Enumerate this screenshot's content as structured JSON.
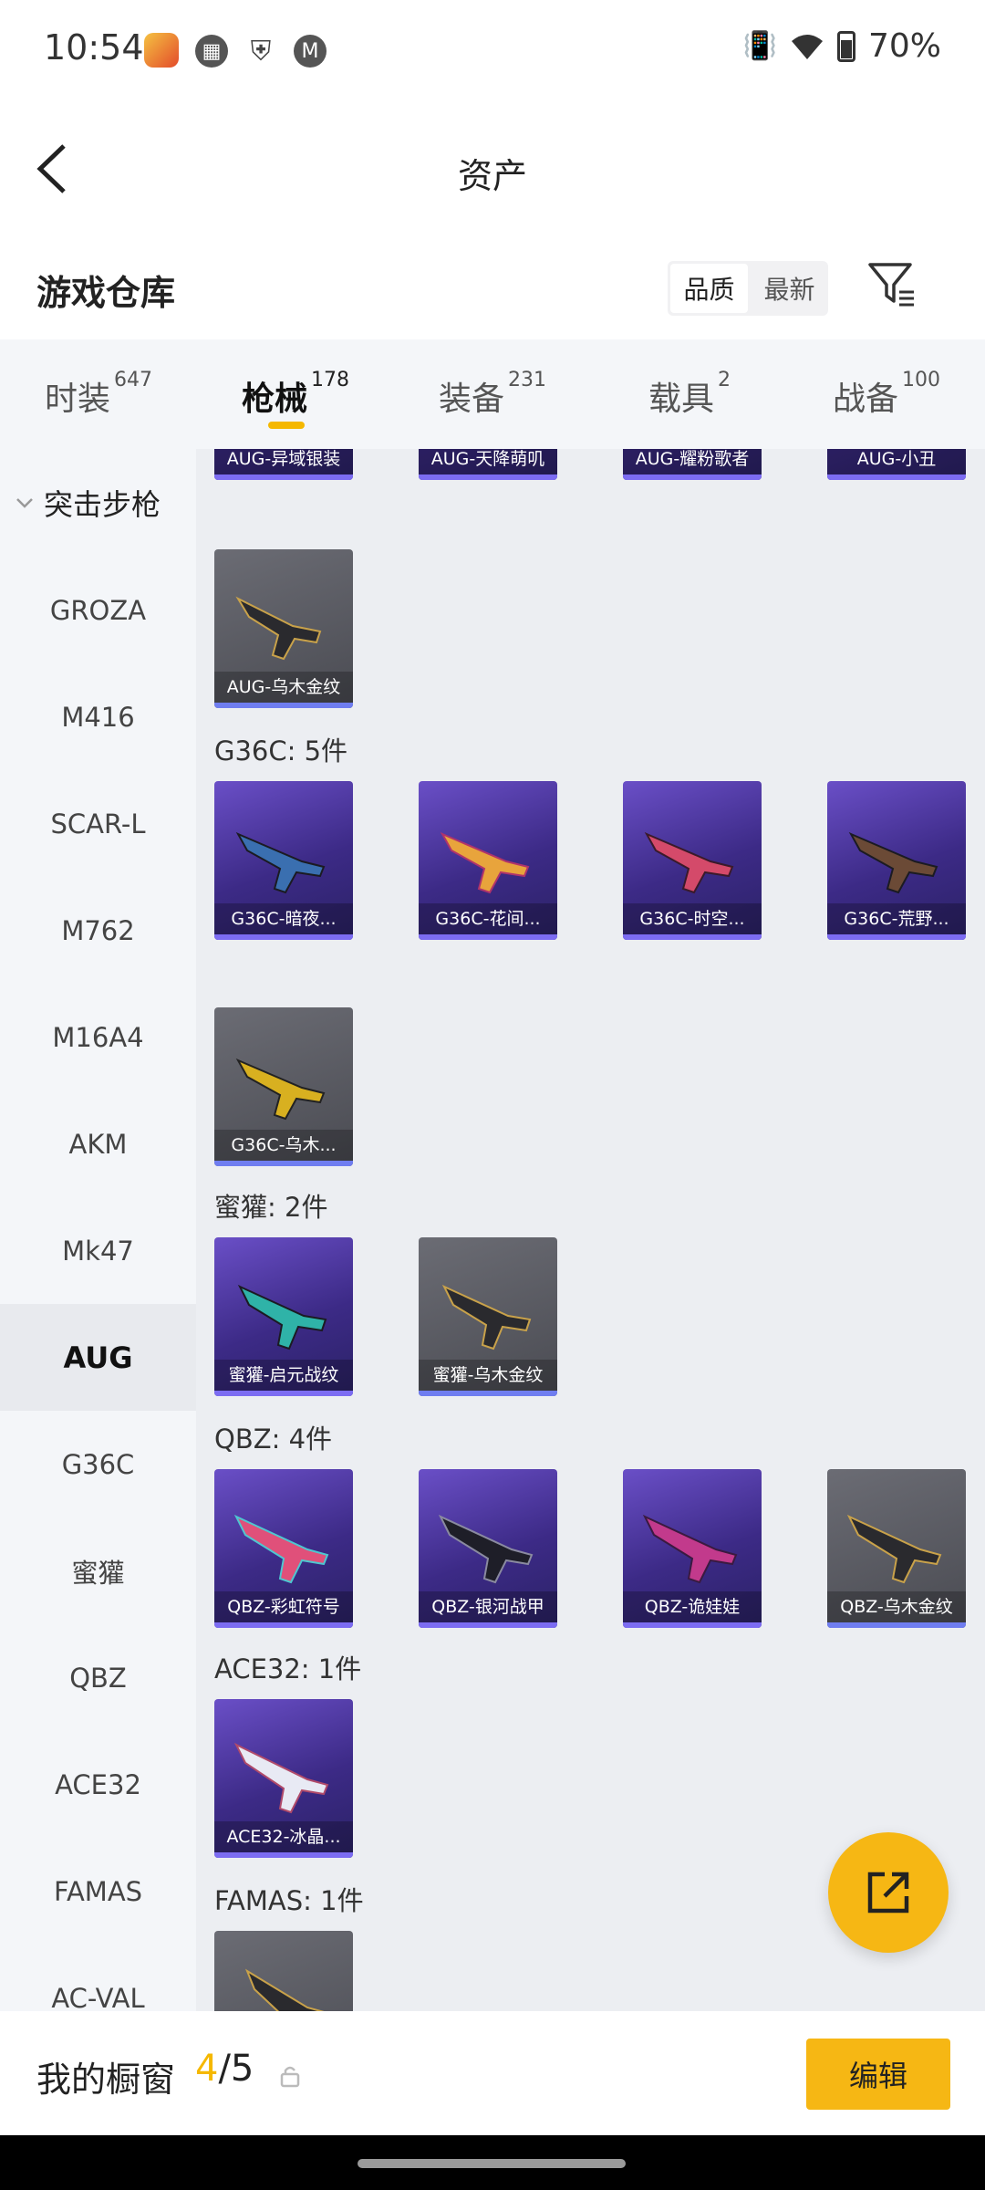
{
  "status_bar": {
    "time": "10:54",
    "battery": "70%"
  },
  "header": {
    "title": "资产"
  },
  "section": {
    "title": "游戏仓库",
    "sort_options": [
      "品质",
      "最新"
    ]
  },
  "tabs": [
    {
      "label": "时装",
      "count": "647"
    },
    {
      "label": "枪械",
      "count": "178"
    },
    {
      "label": "装备",
      "count": "231"
    },
    {
      "label": "载具",
      "count": "2"
    },
    {
      "label": "战备",
      "count": "100"
    }
  ],
  "sidebar": {
    "group": "突击步枪",
    "items": [
      "GROZA",
      "M416",
      "SCAR-L",
      "M762",
      "M16A4",
      "AKM",
      "Mk47",
      "AUG",
      "G36C",
      "蜜獾",
      "QBZ",
      "ACE32",
      "FAMAS",
      "AC-VAL"
    ],
    "active_index": 7
  },
  "groups": {
    "g36c": "G36C: 5件",
    "mihuan": "蜜獾: 2件",
    "qbz": "QBZ: 4件",
    "ace32": "ACE32: 1件",
    "famas": "FAMAS: 1件"
  },
  "cards": {
    "aug_row": [
      "AUG-异域银装",
      "AUG-天降萌叽",
      "AUG-耀粉歌者",
      "AUG-小丑"
    ],
    "aug_last": "AUG-乌木金纹",
    "g36c": [
      "G36C-暗夜...",
      "G36C-花间...",
      "G36C-时空...",
      "G36C-荒野...",
      "G36C-乌木..."
    ],
    "mihuan": [
      "蜜獾-启元战纹",
      "蜜獾-乌木金纹"
    ],
    "qbz": [
      "QBZ-彩虹符号",
      "QBZ-银河战甲",
      "QBZ-诡娃娃",
      "QBZ-乌木金纹"
    ],
    "ace32": [
      "ACE32-冰晶..."
    ]
  },
  "bottom": {
    "showcase_label": "我的橱窗",
    "showcase_current": "4",
    "showcase_total": "/5",
    "edit_label": "编辑"
  }
}
